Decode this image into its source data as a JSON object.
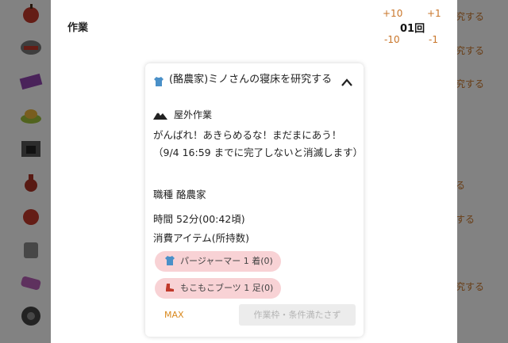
{
  "background": {
    "right_labels": [
      "究する",
      "究する",
      "究する",
      "る",
      "する",
      "究する"
    ],
    "colors": {
      "accent": "#c9762a",
      "overlay": "rgba(0,0,0,0.48)"
    }
  },
  "modal": {
    "title": "作業",
    "stepper": {
      "plus10": "+10",
      "plus1": "+1",
      "minus10": "-10",
      "minus1": "-1",
      "count": "01回"
    },
    "card": {
      "title": "(酪農家)ミノさんの寝床を研究する",
      "location": "屋外作業",
      "description": "がんばれ！あきらめるな！まだまにあう！（9/4 16:59 までに完了しないと消滅します）",
      "job": "職種 酪農家",
      "time": "時間 52分(00:42頃)",
      "consumed_label": "消費アイテム(所持数)",
      "items": [
        {
          "label": "パージャーマー 1 着(0)",
          "icon": "shirt-icon"
        },
        {
          "label": "もこもこブーツ 1 足(0)",
          "icon": "boots-icon"
        }
      ],
      "max_label": "MAX",
      "start_label": "作業枠・条件満たさず"
    }
  }
}
